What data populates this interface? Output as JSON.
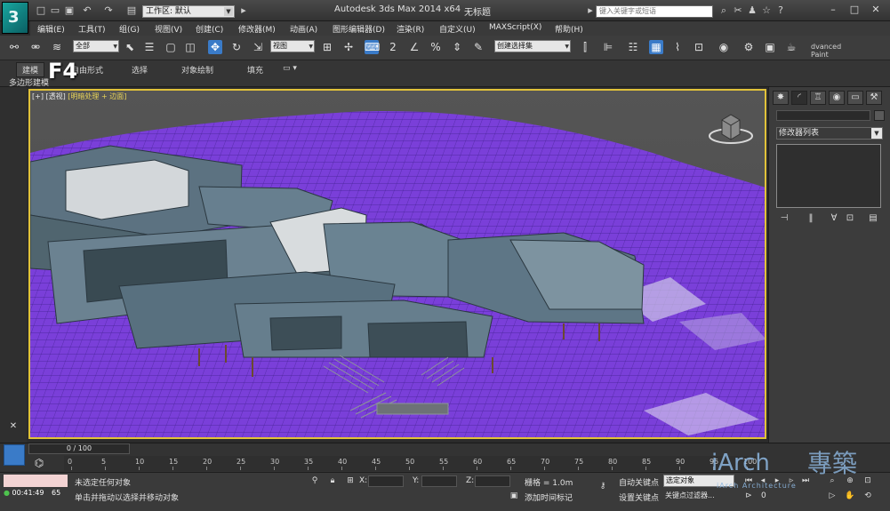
{
  "app": {
    "title": "Autodesk 3ds Max  2014 x64",
    "doc_title": "无标题",
    "workspace_label": "工作区: 默认",
    "help_search_placeholder": "键入关键字或短语"
  },
  "menu": [
    "编辑(E)",
    "工具(T)",
    "组(G)",
    "视图(V)",
    "创建(C)",
    "修改器(M)",
    "动画(A)",
    "图形编辑器(D)",
    "渲染(R)",
    "自定义(U)",
    "MAXScript(X)",
    "帮助(H)"
  ],
  "toolbar": {
    "selection_filter": "全部",
    "ref_coord": "视图",
    "named_selection": "创建选择集",
    "paint_label": "dvanced Paint"
  },
  "ribbon": {
    "tabs": [
      "建模",
      "自由形式",
      "选择",
      "对象绘制",
      "填充"
    ],
    "active_tab": "建模",
    "sub_label": "多边形建模",
    "overlay_key": "F4"
  },
  "viewport": {
    "label_plus": "[+]",
    "label_view": "[透视]",
    "label_shading": "[明暗处理 + 边面]",
    "terrain_color": "#7a3fd9",
    "building_color": "#5c7281"
  },
  "command_panel": {
    "modifier_list": "修改器列表"
  },
  "timeline": {
    "slider_text": "0 / 100",
    "ticks": [
      0,
      5,
      10,
      15,
      20,
      25,
      30,
      35,
      40,
      45,
      50,
      55,
      60,
      65,
      70,
      75,
      80,
      85,
      90,
      95,
      100
    ]
  },
  "status": {
    "elapsed": "00:41:49",
    "frame_hint": "65",
    "selection_msg": "未选定任何对象",
    "prompt_msg": "单击并拖动以选择并移动对象",
    "x_label": "X:",
    "y_label": "Y:",
    "z_label": "Z:",
    "grid": "栅格 = 1.0m",
    "add_time_tag": "添加时间标记",
    "auto_key": "自动关键点",
    "set_key": "设置关键点",
    "selected_object": "选定对象",
    "key_filters": "关键点过滤器...",
    "current_frame": "0"
  },
  "watermark": {
    "brand": "iArch",
    "cn": "專築",
    "tagline": "iArch Architecture"
  }
}
